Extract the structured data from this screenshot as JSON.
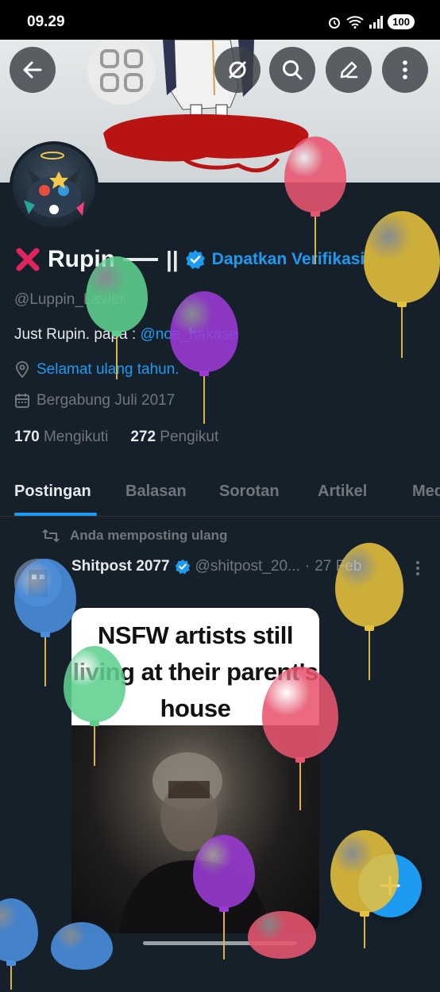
{
  "status_bar": {
    "time": "09.29",
    "battery": "100"
  },
  "profile": {
    "name": "Rupin",
    "name_suffix": "|| ",
    "verify_label": "Dapatkan Verifikasi",
    "handle": "@Luppin_Lavier",
    "bio_text": "Just Rupin. papa : ",
    "bio_mention": "@noe_hakase",
    "location": "Selamat ulang tahun.",
    "joined": "Bergabung Juli 2017",
    "following_count": "170",
    "following_label": "Mengikuti",
    "followers_count": "272",
    "followers_label": "Pengikut"
  },
  "tabs": [
    "Postingan",
    "Balasan",
    "Sorotan",
    "Artikel",
    "Media"
  ],
  "active_tab": "Postingan",
  "post": {
    "repost_label": "Anda memposting ulang",
    "author_name": "Shitpost 2077",
    "author_handle": "@shitpost_20...",
    "date": "27 Feb",
    "media_caption": "NSFW artists still living at their parent's house"
  },
  "colors": {
    "accent": "#1d9bf0",
    "background": "#15202b",
    "error_red": "#e0245e"
  },
  "icons": [
    "back-arrow-icon",
    "grid-icon",
    "no-sync-icon",
    "search-icon",
    "edit-icon",
    "more-vertical-icon",
    "verified-badge-icon",
    "location-pin-icon",
    "calendar-icon",
    "repost-icon",
    "plus-icon"
  ]
}
